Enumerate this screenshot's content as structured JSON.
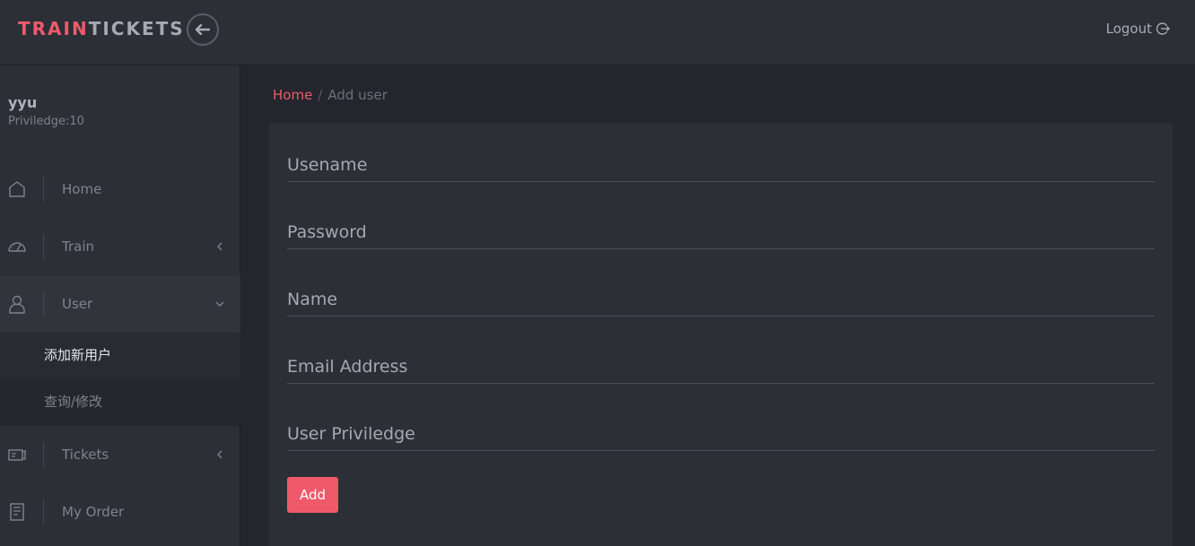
{
  "header": {
    "brand_part1": "TRAIN",
    "brand_part2": "TICKETS",
    "back_icon": "arrow-left-icon",
    "logout_label": "Logout",
    "logout_icon": "logout-icon"
  },
  "sidebar": {
    "user": {
      "name": "yyu",
      "privilege": "Priviledge:10"
    },
    "items": [
      {
        "label": "Home",
        "icon": "home-icon"
      },
      {
        "label": "Train",
        "icon": "dashboard-icon",
        "chevron": "chevron-left-icon"
      },
      {
        "label": "User",
        "icon": "user-icon",
        "chevron": "chevron-down-icon",
        "active": true
      },
      {
        "label": "Tickets",
        "icon": "ticket-icon",
        "chevron": "chevron-left-icon"
      },
      {
        "label": "My Order",
        "icon": "receipt-icon"
      }
    ],
    "user_submenu": [
      {
        "label": "添加新用户",
        "selected": true
      },
      {
        "label": "查询/修改",
        "selected": false
      }
    ]
  },
  "breadcrumb": {
    "home": "Home",
    "separator": "/",
    "current": "Add user"
  },
  "form": {
    "username_placeholder": "Usename",
    "password_placeholder": "Password",
    "name_placeholder": "Name",
    "email_placeholder": "Email Address",
    "privilege_placeholder": "User Priviledge",
    "add_label": "Add"
  },
  "colors": {
    "accent": "#ee5a6a",
    "topbar_bg": "#2c2f35",
    "page_bg": "#23262c"
  }
}
